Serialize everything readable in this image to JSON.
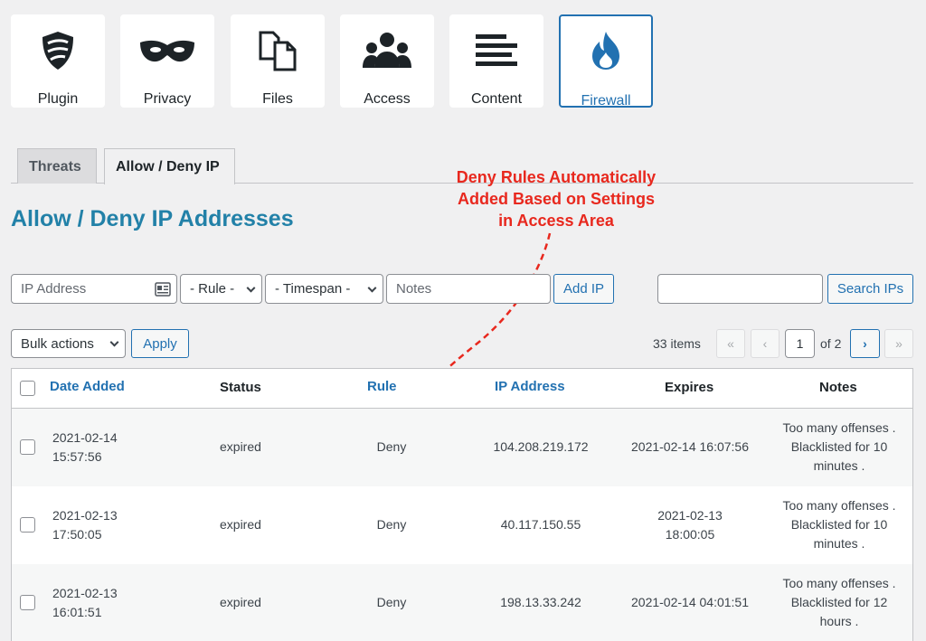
{
  "modules": [
    {
      "label": "Plugin",
      "icon": "shield-icon"
    },
    {
      "label": "Privacy",
      "icon": "mask-icon"
    },
    {
      "label": "Files",
      "icon": "files-icon"
    },
    {
      "label": "Access",
      "icon": "users-icon"
    },
    {
      "label": "Content",
      "icon": "lines-icon"
    },
    {
      "label": "Firewall",
      "icon": "flame-icon",
      "active": true
    }
  ],
  "tabs": [
    {
      "label": "Threats"
    },
    {
      "label": "Allow / Deny IP",
      "active": true
    }
  ],
  "page_title": "Allow / Deny IP Addresses",
  "annotation": {
    "lines": [
      "Deny Rules Automatically",
      "Added Based on Settings",
      "in Access Area"
    ],
    "color": "#e8281e"
  },
  "add_form": {
    "ip_placeholder": "IP Address",
    "rule_select": "- Rule -",
    "timespan_select": "- Timespan -",
    "notes_placeholder": "Notes",
    "add_button": "Add IP"
  },
  "search": {
    "value": "",
    "button": "Search IPs"
  },
  "bulk": {
    "select": "Bulk actions",
    "apply": "Apply"
  },
  "pagination": {
    "items": "33 items",
    "first": "«",
    "prev": "‹",
    "current": "1",
    "of": "of 2",
    "next": "›",
    "last": "»"
  },
  "table": {
    "headers": {
      "date": "Date Added",
      "status": "Status",
      "rule": "Rule",
      "ip": "IP Address",
      "expires": "Expires",
      "notes": "Notes"
    },
    "rows": [
      {
        "date1": "2021-02-14",
        "date2": "15:57:56",
        "status": "expired",
        "rule": "Deny",
        "ip": "104.208.219.172",
        "exp1": "2021-02-14 16:07:56",
        "exp2": "",
        "n1": "Too many offenses .",
        "n2": "Blacklisted for 10",
        "n3": "minutes ."
      },
      {
        "date1": "2021-02-13",
        "date2": "17:50:05",
        "status": "expired",
        "rule": "Deny",
        "ip": "40.117.150.55",
        "exp1": "2021-02-13",
        "exp2": "18:00:05",
        "n1": "Too many offenses .",
        "n2": "Blacklisted for 10",
        "n3": "minutes ."
      },
      {
        "date1": "2021-02-13",
        "date2": "16:01:51",
        "status": "expired",
        "rule": "Deny",
        "ip": "198.13.33.242",
        "exp1": "2021-02-14 04:01:51",
        "exp2": "",
        "n1": "Too many offenses .",
        "n2": "Blacklisted for 12",
        "n3": "hours ."
      }
    ]
  },
  "colors": {
    "accent": "#2271b1",
    "title": "#2281a8"
  }
}
